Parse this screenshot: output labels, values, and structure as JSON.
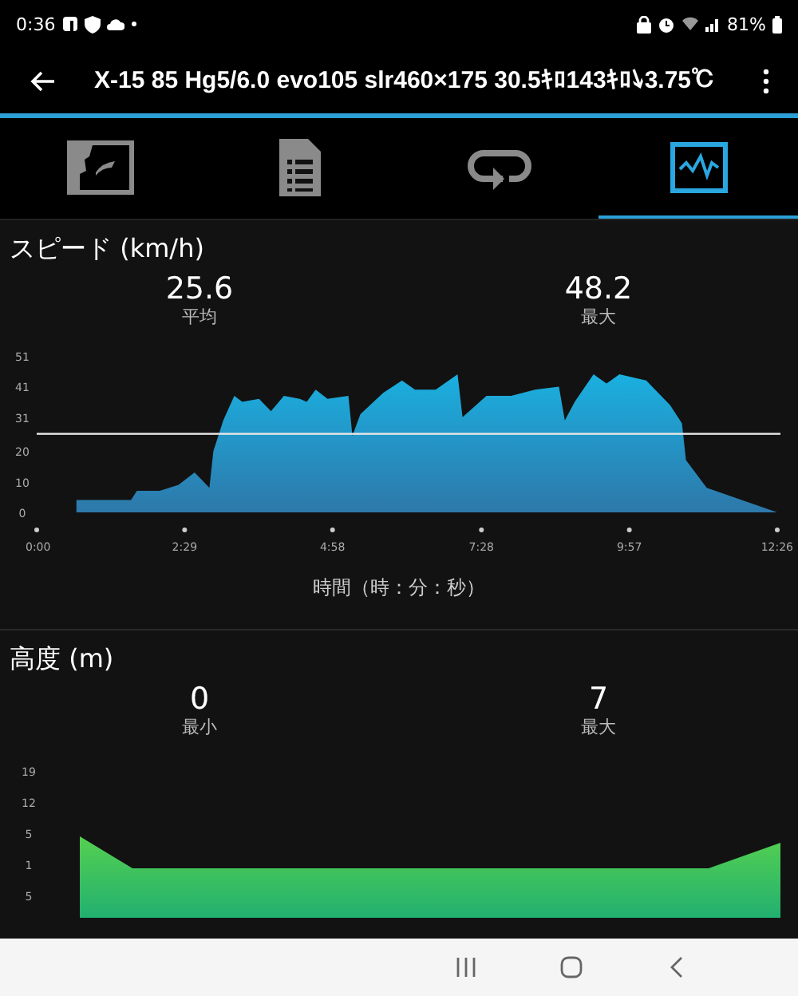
{
  "status_bar": {
    "time": "0:36",
    "battery": "81%"
  },
  "app_bar": {
    "title": "X-15 85 Hg5/6.0 evo105 slr460×175 30.5ｷﾛ143ｷﾛ↘3.75℃"
  },
  "tabs": [
    {
      "kind": "map",
      "selected": false
    },
    {
      "kind": "details",
      "selected": false
    },
    {
      "kind": "laps",
      "selected": false
    },
    {
      "kind": "graph",
      "selected": true
    }
  ],
  "speed": {
    "title": "スピード (km/h)",
    "stats": [
      {
        "value": "25.6",
        "label": "平均"
      },
      {
        "value": "48.2",
        "label": "最大"
      }
    ],
    "chart_data": {
      "type": "area",
      "xlabel": "時間（時：分：秒）",
      "xlim": [
        0,
        746
      ],
      "ylim": [
        0,
        51
      ],
      "x": [
        40,
        95,
        101,
        124,
        143,
        159,
        174,
        178,
        188,
        199,
        207,
        224,
        236,
        249,
        265,
        272,
        281,
        293,
        314,
        318,
        326,
        349,
        368,
        381,
        402,
        424,
        429,
        453,
        478,
        502,
        526,
        532,
        542,
        561,
        574,
        587,
        614,
        638,
        650,
        654,
        675,
        746
      ],
      "series": [
        {
          "color": "#1ab0e0",
          "values": [
            4,
            4,
            7,
            7,
            9,
            13,
            8,
            20,
            30,
            38,
            36,
            37,
            33,
            38,
            37,
            36,
            40,
            37,
            38,
            25,
            32,
            39,
            43,
            40,
            40,
            45,
            31,
            38,
            38,
            40,
            41,
            30,
            36,
            45,
            42,
            45,
            43,
            35,
            29,
            17,
            8,
            0
          ]
        }
      ],
      "xticks": [
        {
          "value": 0,
          "label": "0:00"
        },
        {
          "value": 149,
          "label": "2:29"
        },
        {
          "value": 298,
          "label": "4:58"
        },
        {
          "value": 448,
          "label": "7:28"
        },
        {
          "value": 597,
          "label": "9:57"
        },
        {
          "value": 746,
          "label": "12:26"
        }
      ],
      "yticks": [
        0,
        10,
        20,
        31,
        41,
        51
      ],
      "ref_lines": [
        {
          "axis": "y",
          "value": 25.6
        }
      ]
    }
  },
  "altitude": {
    "title": "高度 (m)",
    "stats": [
      {
        "value": "0",
        "label": "最小"
      },
      {
        "value": "7",
        "label": "最大"
      }
    ],
    "axis_labels": [
      "19",
      "12",
      "5",
      "1",
      "5"
    ]
  }
}
